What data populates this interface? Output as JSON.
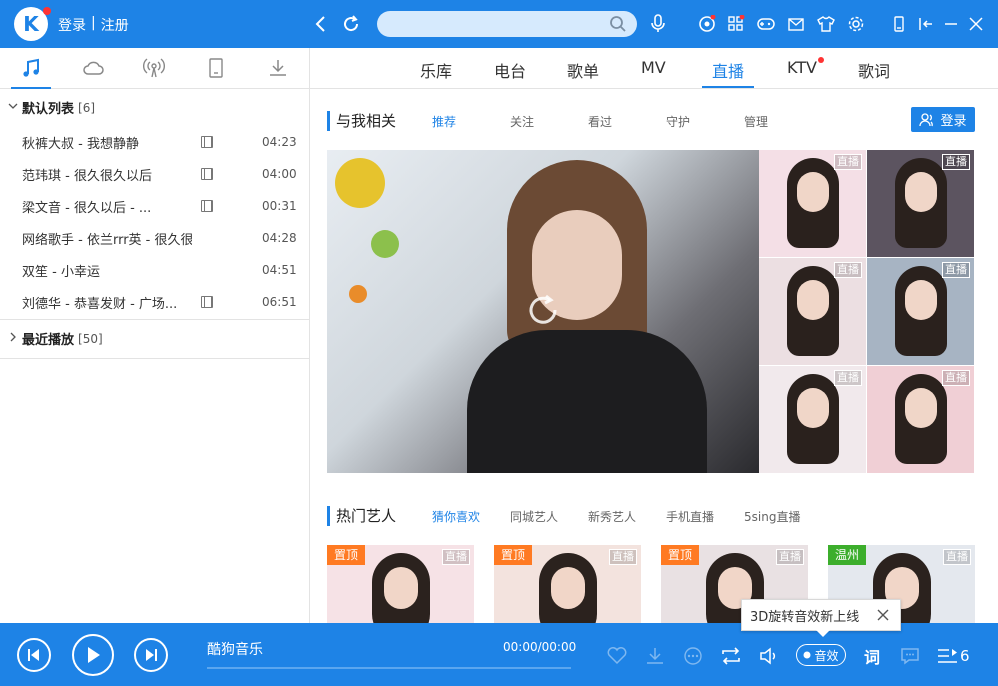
{
  "topbar": {
    "logo": "K",
    "login": "登录",
    "separator": "|",
    "register": "注册",
    "search_placeholder": ""
  },
  "sidebar": {
    "default_list": {
      "label": "默认列表",
      "count": "[6]"
    },
    "songs": [
      {
        "title": "秋裤大叔 - 我想静静",
        "duration": "04:23",
        "mv": true
      },
      {
        "title": "范玮琪 - 很久很久以后",
        "duration": "04:00",
        "mv": true
      },
      {
        "title": "梁文音 - 很久以后 - ...",
        "duration": "00:31",
        "mv": true
      },
      {
        "title": "网络歌手 - 依兰rrr英 - 很久很...",
        "duration": "04:28",
        "mv": false
      },
      {
        "title": "双笙 - 小幸运",
        "duration": "04:51",
        "mv": false
      },
      {
        "title": "刘德华 - 恭喜发财 - 广场...",
        "duration": "06:51",
        "mv": true
      }
    ],
    "recent": {
      "label": "最近播放",
      "count": "[50]"
    }
  },
  "nav": {
    "tabs": [
      "乐库",
      "电台",
      "歌单",
      "MV",
      "直播",
      "KTV",
      "歌词"
    ],
    "active": "直播"
  },
  "related": {
    "title": "与我相关",
    "tabs": [
      "推荐",
      "关注",
      "看过",
      "守护",
      "管理"
    ],
    "login_btn": "登录"
  },
  "live_tag": "直播",
  "hot": {
    "title": "热门艺人",
    "tabs": [
      "猜你喜欢",
      "同城艺人",
      "新秀艺人",
      "手机直播",
      "5sing直播"
    ],
    "cards": [
      {
        "badge": "置顶",
        "badge_color": "#ff7a22"
      },
      {
        "badge": "置顶",
        "badge_color": "#ff7a22"
      },
      {
        "badge": "置顶",
        "badge_color": "#ff7a22"
      },
      {
        "badge": "温州",
        "badge_color": "#3cae2c"
      }
    ]
  },
  "player": {
    "song": "酷狗音乐",
    "time": "00:00/00:00",
    "effect": "音效",
    "lyric": "词",
    "queue_count": "6"
  },
  "toast": {
    "text": "3D旋转音效新上线"
  },
  "colors": {
    "brand": "#1e83e6",
    "badge_orange": "#ff7a22",
    "badge_green": "#3cae2c",
    "dot_red": "#ff3333"
  }
}
